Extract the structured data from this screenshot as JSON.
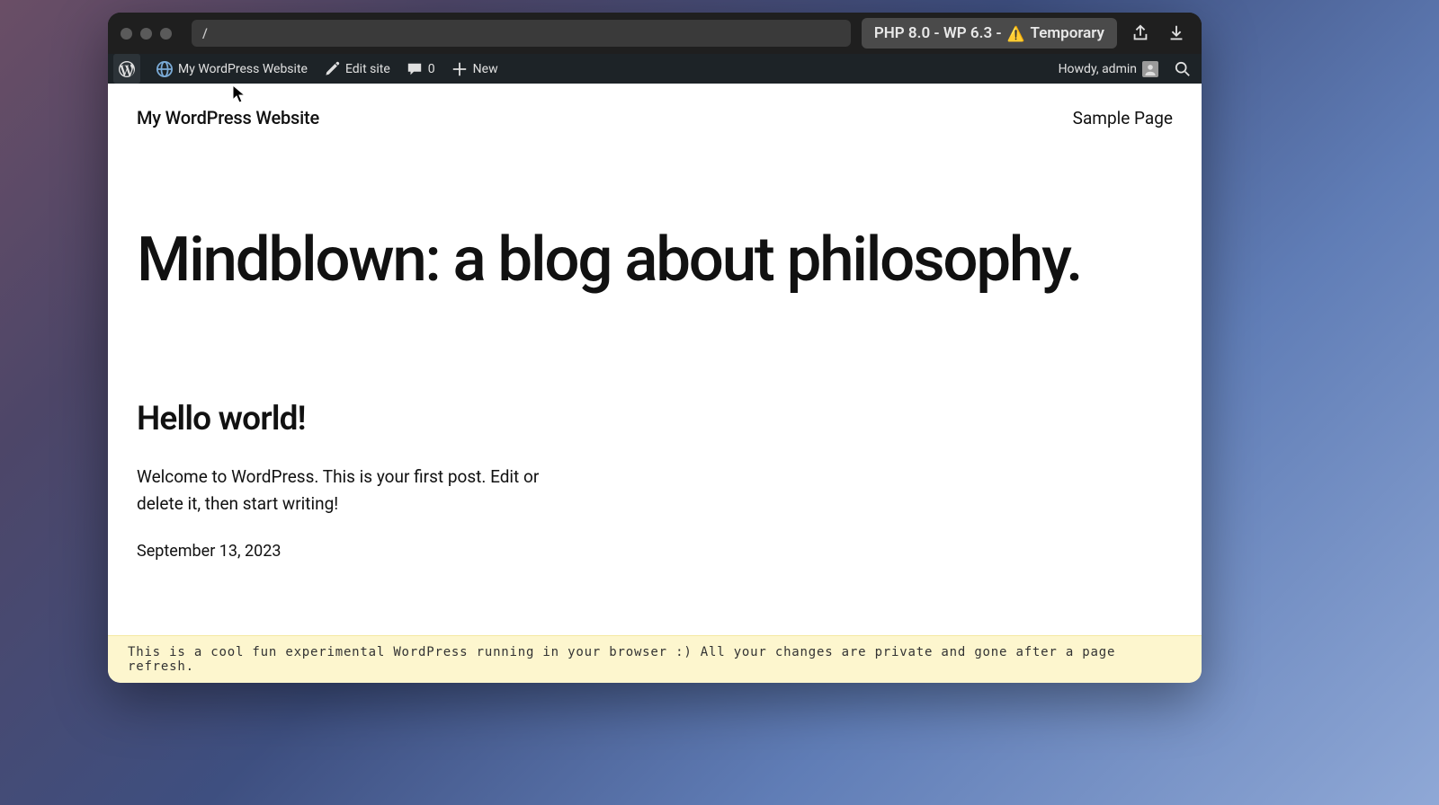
{
  "chrome": {
    "url_value": "/",
    "env_prefix": "PHP 8.0 - WP 6.3 - ",
    "env_temporary": "Temporary"
  },
  "adminbar": {
    "site_name": "My WordPress Website",
    "edit_site": "Edit site",
    "comments_count": "0",
    "new_label": "New",
    "howdy": "Howdy, admin"
  },
  "site": {
    "title": "My WordPress Website",
    "nav_item": "Sample Page"
  },
  "hero": {
    "heading": "Mindblown: a blog about philosophy."
  },
  "post": {
    "title": "Hello world!",
    "excerpt": "Welcome to WordPress. This is your first post. Edit or delete it, then start writing!",
    "date": "September 13, 2023"
  },
  "banner": {
    "text": "This is a cool fun experimental WordPress running in your browser :) All your changes are private and gone after a page refresh."
  }
}
